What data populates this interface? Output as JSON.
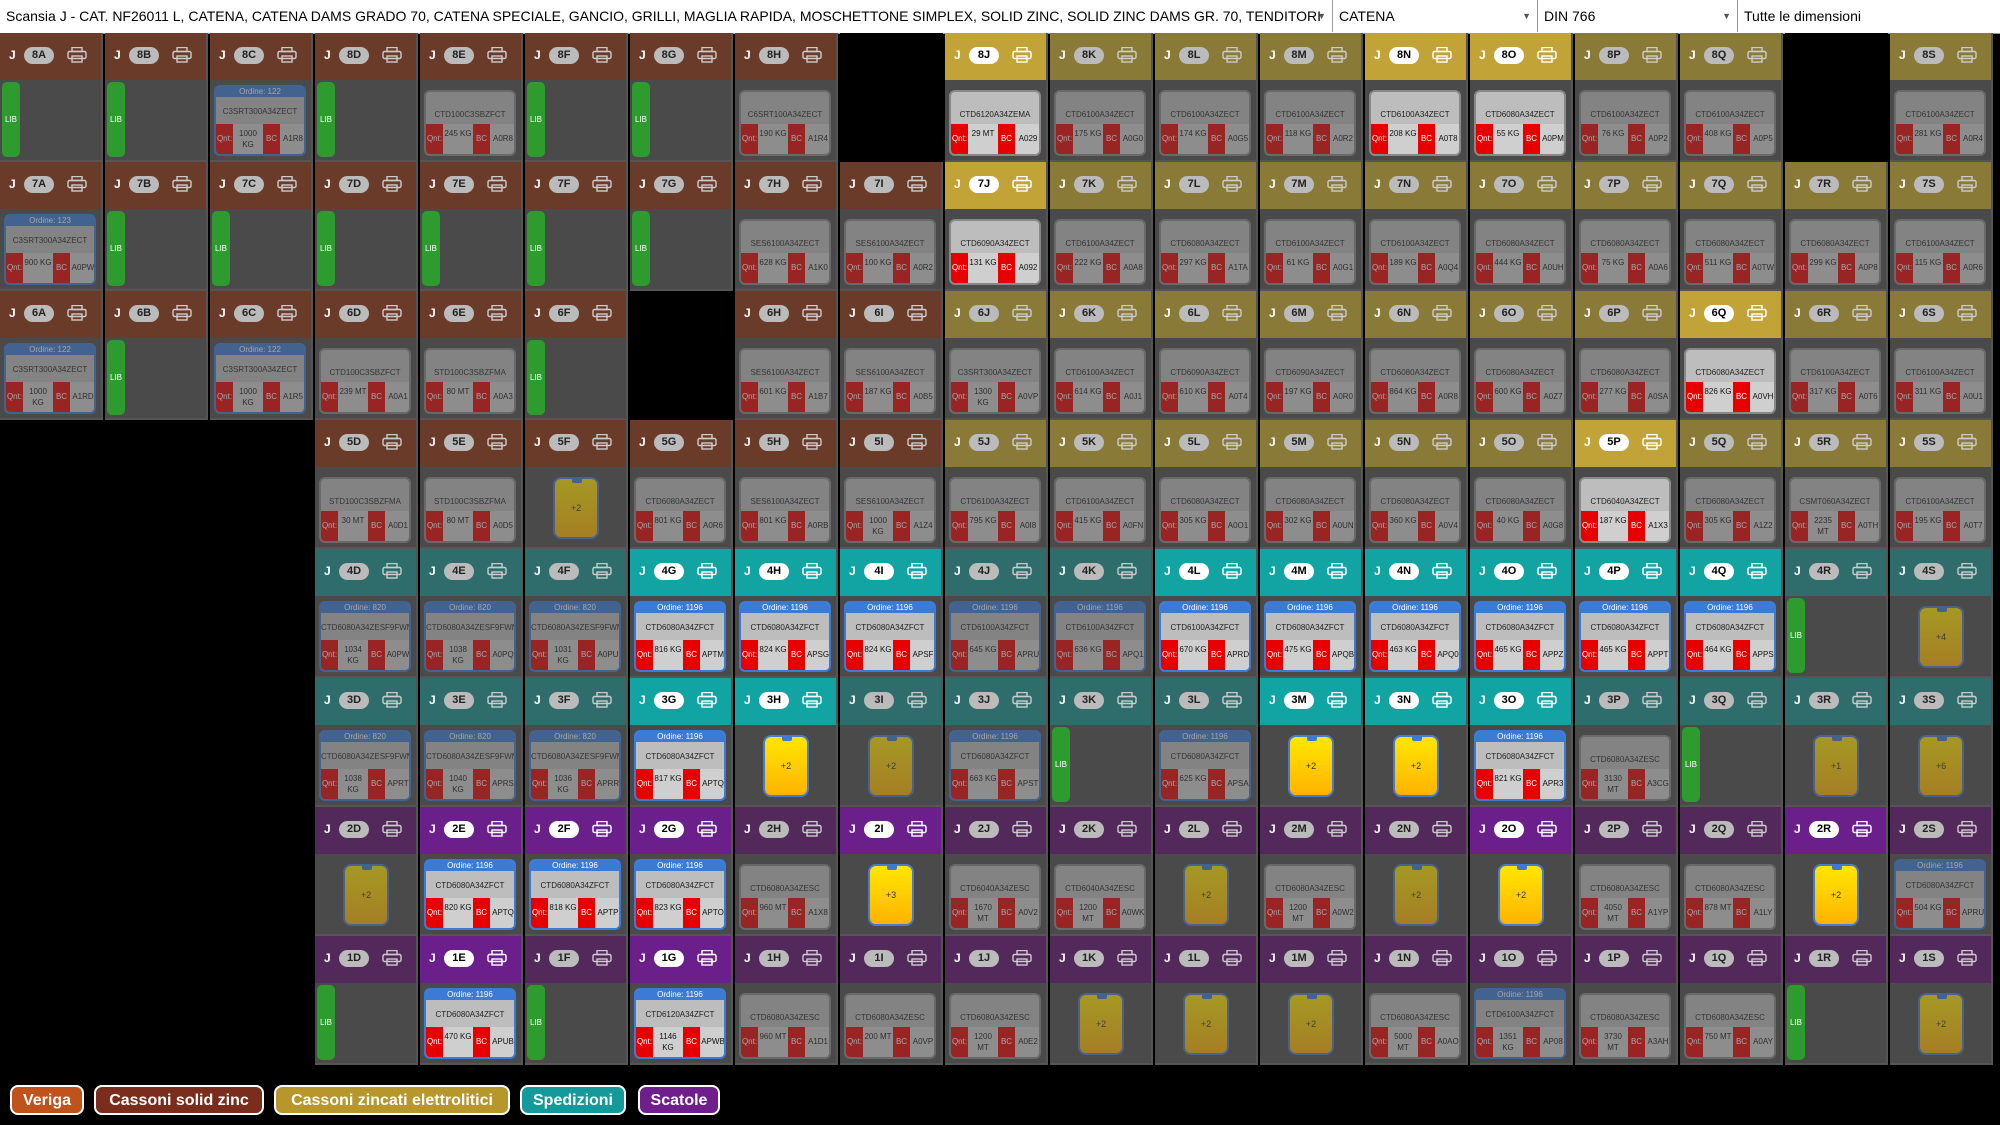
{
  "filters": {
    "scansia": "Scansia J - CAT. NF26011 L, CATENA, CATENA DAMS GRADO 70, CATENA SPECIALE, GANCIO, GRILLI, MAGLIA RAPIDA, MOSCHETTONE SIMPLEX, SOLID ZINC, SOLID ZINC DAMS GR. 70, TENDITORI",
    "category": "CATENA",
    "norm": "DIN 766",
    "dimension": "Tutte le dimensioni"
  },
  "shelf_letter": "J",
  "columns": [
    "A",
    "B",
    "C",
    "D",
    "E",
    "F",
    "G",
    "H",
    "I",
    "J",
    "K",
    "L",
    "M",
    "N",
    "O",
    "P",
    "Q",
    "R",
    "S"
  ],
  "levels": [
    8,
    7,
    6,
    5,
    4,
    3,
    2,
    1
  ],
  "labels": {
    "free": "LIB",
    "qty": "Qnt:",
    "bc": "BC"
  },
  "colors": {
    "veriga": "#7a3a24",
    "solid_zinc": "#6b3b2a",
    "zincati": "#8a7a38",
    "zincati_active": "#c2a338",
    "spedizioni": "#2f6d6d",
    "spedizioni_active": "#12a3a3",
    "scatole": "#52295a",
    "scatole_active": "#6a1f8a"
  },
  "legend": [
    {
      "label": "Veriga",
      "color": "#c0521c"
    },
    {
      "label": "Cassoni solid zinc",
      "color": "#7a2d1c"
    },
    {
      "label": "Cassoni zincati elettrolitici",
      "color": "#b7962c"
    },
    {
      "label": "Spedizioni",
      "color": "#149a9a"
    },
    {
      "label": "Scatole",
      "color": "#6e1f8c"
    }
  ],
  "cells": {
    "8A": {
      "c": "r",
      "t": "lib"
    },
    "8B": {
      "c": "r",
      "t": "lib"
    },
    "8C": {
      "c": "r",
      "t": "box",
      "code": "C3SRT300A34ZECT",
      "q": "1000 KG",
      "id": "A1R8",
      "ord": "Ordine: 122"
    },
    "8D": {
      "c": "r",
      "t": "lib"
    },
    "8E": {
      "c": "r",
      "t": "box",
      "code": "CTD100C3SBZFCT",
      "q": "245 KG",
      "id": "A0R8"
    },
    "8F": {
      "c": "r",
      "t": "lib"
    },
    "8G": {
      "c": "r",
      "t": "lib"
    },
    "8H": {
      "c": "r",
      "t": "box",
      "code": "C6SRT100A34ZECT",
      "q": "190 KG",
      "id": "A1R4"
    },
    "8I": {
      "c": "x"
    },
    "8J": {
      "c": "y",
      "a": 1,
      "t": "box",
      "code": "CTD6120A34ZEMA",
      "q": "29 MT",
      "id": "A029"
    },
    "8K": {
      "c": "y",
      "t": "box",
      "code": "CTD6100A34ZECT",
      "q": "175 KG",
      "id": "A0G0"
    },
    "8L": {
      "c": "y",
      "t": "box",
      "code": "CTD6100A34ZECT",
      "q": "174 KG",
      "id": "A0G5"
    },
    "8M": {
      "c": "y",
      "t": "box",
      "code": "CTD6100A34ZECT",
      "q": "118 KG",
      "id": "A0R2"
    },
    "8N": {
      "c": "y",
      "a": 1,
      "t": "box",
      "code": "CTD6100A34ZECT",
      "q": "208 KG",
      "id": "A0T8"
    },
    "8O": {
      "c": "y",
      "a": 1,
      "t": "box",
      "code": "CTD6080A34ZECT",
      "q": "55 KG",
      "id": "A0PM"
    },
    "8P": {
      "c": "y",
      "t": "box",
      "code": "CTD6100A34ZECT",
      "q": "76 KG",
      "id": "A0P2"
    },
    "8Q": {
      "c": "y",
      "t": "box",
      "code": "CTD6100A34ZECT",
      "q": "408 KG",
      "id": "A0P5"
    },
    "8R": {
      "c": "x"
    },
    "8S": {
      "c": "y",
      "t": "box",
      "code": "CTD6100A34ZECT",
      "q": "281 KG",
      "id": "A0R4"
    },
    "7A": {
      "c": "r",
      "t": "box",
      "code": "C3SRT300A34ZECT",
      "q": "900 KG",
      "id": "A0PW",
      "ord": "Ordine: 123"
    },
    "7B": {
      "c": "r",
      "t": "lib"
    },
    "7C": {
      "c": "r",
      "t": "lib"
    },
    "7D": {
      "c": "r",
      "t": "lib"
    },
    "7E": {
      "c": "r",
      "t": "lib"
    },
    "7F": {
      "c": "r",
      "t": "lib"
    },
    "7G": {
      "c": "r",
      "t": "lib"
    },
    "7H": {
      "c": "r",
      "t": "box",
      "code": "SES6100A34ZECT",
      "q": "628 KG",
      "id": "A1K0"
    },
    "7I": {
      "c": "r",
      "t": "box",
      "code": "SES6100A34ZECT",
      "q": "100 KG",
      "id": "A0R2"
    },
    "7J": {
      "c": "y",
      "a": 1,
      "t": "box",
      "code": "CTD6090A34ZECT",
      "q": "131 KG",
      "id": "A092"
    },
    "7K": {
      "c": "y",
      "t": "box",
      "code": "CTD6100A34ZECT",
      "q": "222 KG",
      "id": "A0A8"
    },
    "7L": {
      "c": "y",
      "t": "box",
      "code": "CTD6080A34ZECT",
      "q": "297 KG",
      "id": "A1TA"
    },
    "7M": {
      "c": "y",
      "t": "box",
      "code": "CTD6100A34ZECT",
      "q": "61 KG",
      "id": "A0G1"
    },
    "7N": {
      "c": "y",
      "t": "box",
      "code": "CTD6100A34ZECT",
      "q": "189 KG",
      "id": "A0Q4"
    },
    "7O": {
      "c": "y",
      "t": "box",
      "code": "CTD6080A34ZECT",
      "q": "444 KG",
      "id": "A0UH"
    },
    "7P": {
      "c": "y",
      "t": "box",
      "code": "CTD6080A34ZECT",
      "q": "75 KG",
      "id": "A0A6"
    },
    "7Q": {
      "c": "y",
      "t": "box",
      "code": "CTD6080A34ZECT",
      "q": "511 KG",
      "id": "A0TW"
    },
    "7R": {
      "c": "y",
      "t": "box",
      "code": "CTD6080A34ZECT",
      "q": "299 KG",
      "id": "A0P8"
    },
    "7S": {
      "c": "y",
      "t": "box",
      "code": "CTD6100A34ZECT",
      "q": "115 KG",
      "id": "A0R6"
    },
    "6A": {
      "c": "r",
      "t": "box",
      "code": "C3SRT300A34ZECT",
      "q": "1000 KG",
      "id": "A1RD",
      "ord": "Ordine: 122"
    },
    "6B": {
      "c": "r",
      "t": "lib"
    },
    "6C": {
      "c": "r",
      "t": "box",
      "code": "C3SRT300A34ZECT",
      "q": "1000 KG",
      "id": "A1R5",
      "ord": "Ordine: 122"
    },
    "6D": {
      "c": "r",
      "t": "box",
      "code": "CTD100C3SBZFCT",
      "q": "239 MT",
      "id": "A0A1"
    },
    "6E": {
      "c": "r",
      "t": "box",
      "code": "STD100C3SBZFMA",
      "q": "80 MT",
      "id": "A0A3"
    },
    "6F": {
      "c": "r",
      "t": "lib"
    },
    "6H": {
      "c": "r",
      "t": "box",
      "code": "SES6100A34ZECT",
      "q": "601 KG",
      "id": "A1B7"
    },
    "6I": {
      "c": "r",
      "t": "box",
      "code": "SES6100A34ZECT",
      "q": "187 KG",
      "id": "A0B5"
    },
    "6J": {
      "c": "y",
      "t": "box",
      "code": "C3SRT300A34ZECT",
      "q": "1300 KG",
      "id": "A0VP"
    },
    "6K": {
      "c": "y",
      "t": "box",
      "code": "CTD6100A34ZECT",
      "q": "614 KG",
      "id": "A0J1"
    },
    "6L": {
      "c": "y",
      "t": "box",
      "code": "CTD6090A34ZECT",
      "q": "610 KG",
      "id": "A0T4"
    },
    "6M": {
      "c": "y",
      "t": "box",
      "code": "CTD6090A34ZECT",
      "q": "197 KG",
      "id": "A0R0"
    },
    "6N": {
      "c": "y",
      "t": "box",
      "code": "CTD6080A34ZECT",
      "q": "864 KG",
      "id": "A0R8"
    },
    "6O": {
      "c": "y",
      "t": "box",
      "code": "CTD6080A34ZECT",
      "q": "600 KG",
      "id": "A0Z7"
    },
    "6P": {
      "c": "y",
      "t": "box",
      "code": "CTD6080A34ZECT",
      "q": "277 KG",
      "id": "A0SA"
    },
    "6Q": {
      "c": "y",
      "a": 1,
      "t": "box",
      "code": "CTD6080A34ZECT",
      "q": "826 KG",
      "id": "A0VH"
    },
    "6R": {
      "c": "y",
      "t": "box",
      "code": "CTD6100A34ZECT",
      "q": "317 KG",
      "id": "A0T6"
    },
    "6S": {
      "c": "y",
      "t": "box",
      "code": "CTD6100A34ZECT",
      "q": "311 KG",
      "id": "A0U1"
    },
    "5A": {
      "c": "x"
    },
    "5B": {
      "c": "x"
    },
    "5C": {
      "c": "x"
    },
    "5D": {
      "c": "r",
      "t": "box",
      "code": "STD100C3SBZFMA",
      "q": "30 MT",
      "id": "A0D1"
    },
    "5E": {
      "c": "r",
      "t": "box",
      "code": "STD100C3SBZFMA",
      "q": "80 MT",
      "id": "A0D5"
    },
    "5F": {
      "c": "r",
      "t": "jar",
      "n": "+2"
    },
    "5G": {
      "c": "r",
      "t": "box",
      "code": "CTD6080A34ZECT",
      "q": "801 KG",
      "id": "A0R6"
    },
    "5H": {
      "c": "r",
      "t": "box",
      "code": "SES6100A34ZECT",
      "q": "801 KG",
      "id": "A0RB"
    },
    "5I": {
      "c": "r",
      "t": "box",
      "code": "SES6100A34ZECT",
      "q": "1000 KG",
      "id": "A1Z4"
    },
    "5J": {
      "c": "y",
      "t": "box",
      "code": "CTD6100A34ZECT",
      "q": "795 KG",
      "id": "A0I8"
    },
    "5K": {
      "c": "y",
      "t": "box",
      "code": "CTD6100A34ZECT",
      "q": "415 KG",
      "id": "A0FN"
    },
    "5L": {
      "c": "y",
      "t": "box",
      "code": "CTD6080A34ZECT",
      "q": "305 KG",
      "id": "A0O1"
    },
    "5M": {
      "c": "y",
      "t": "box",
      "code": "CTD6080A34ZECT",
      "q": "302 KG",
      "id": "A0UN"
    },
    "5N": {
      "c": "y",
      "t": "box",
      "code": "CTD6080A34ZECT",
      "q": "360 KG",
      "id": "A0V4"
    },
    "5O": {
      "c": "y",
      "t": "box",
      "code": "CTD6080A34ZECT",
      "q": "40 KG",
      "id": "A0G8"
    },
    "5P": {
      "c": "y",
      "a": 1,
      "t": "box",
      "code": "CTD6040A34ZECT",
      "q": "187 KG",
      "id": "A1X3"
    },
    "5Q": {
      "c": "y",
      "t": "box",
      "code": "CTD6080A34ZECT",
      "q": "305 KG",
      "id": "A1Z2"
    },
    "5R": {
      "c": "y",
      "t": "box",
      "code": "CSMT060A34ZECT",
      "q": "2235 MT",
      "id": "A0TH"
    },
    "5S": {
      "c": "y",
      "t": "box",
      "code": "CTD6100A34ZECT",
      "q": "195 KG",
      "id": "A0T7"
    },
    "4A": {
      "c": "x"
    },
    "4B": {
      "c": "x"
    },
    "4C": {
      "c": "x"
    },
    "4D": {
      "c": "t",
      "t": "box",
      "code": "CTD6080A34ZESF9FWM",
      "q": "1034 KG",
      "id": "A0PW",
      "ord": "Ordine: 820"
    },
    "4E": {
      "c": "t",
      "t": "box",
      "code": "CTD6080A34ZESF9FWM",
      "q": "1038 KG",
      "id": "A0PQ",
      "ord": "Ordine: 820"
    },
    "4F": {
      "c": "t",
      "t": "box",
      "code": "CTD6080A34ZESF9FWM",
      "q": "1031 KG",
      "id": "A0PU",
      "ord": "Ordine: 820"
    },
    "4G": {
      "c": "t",
      "a": 1,
      "t": "box",
      "code": "CTD6080A34ZFCT",
      "q": "816 KG",
      "id": "APTM",
      "ord": "Ordine: 1196"
    },
    "4H": {
      "c": "t",
      "a": 1,
      "t": "box",
      "code": "CTD6080A34ZFCT",
      "q": "824 KG",
      "id": "APSG",
      "ord": "Ordine: 1196"
    },
    "4I": {
      "c": "t",
      "a": 1,
      "t": "box",
      "code": "CTD6080A34ZFCT",
      "q": "824 KG",
      "id": "APSF",
      "ord": "Ordine: 1196"
    },
    "4J": {
      "c": "t",
      "t": "box",
      "code": "CTD6100A34ZFCT",
      "q": "645 KG",
      "id": "APRU",
      "ord": "Ordine: 1196"
    },
    "4K": {
      "c": "t",
      "t": "box",
      "code": "CTD6100A34ZFCT",
      "q": "636 KG",
      "id": "APQ1",
      "ord": "Ordine: 1196"
    },
    "4L": {
      "c": "t",
      "a": 1,
      "t": "box",
      "code": "CTD6100A34ZFCT",
      "q": "670 KG",
      "id": "APRD",
      "ord": "Ordine: 1196"
    },
    "4M": {
      "c": "t",
      "a": 1,
      "t": "box",
      "code": "CTD6080A34ZFCT",
      "q": "475 KG",
      "id": "APQB",
      "ord": "Ordine: 1196"
    },
    "4N": {
      "c": "t",
      "a": 1,
      "t": "box",
      "code": "CTD6080A34ZFCT",
      "q": "463 KG",
      "id": "APQ0",
      "ord": "Ordine: 1196"
    },
    "4O": {
      "c": "t",
      "a": 1,
      "t": "box",
      "code": "CTD6080A34ZFCT",
      "q": "465 KG",
      "id": "APPZ",
      "ord": "Ordine: 1196"
    },
    "4P": {
      "c": "t",
      "a": 1,
      "t": "box",
      "code": "CTD6080A34ZFCT",
      "q": "465 KG",
      "id": "APPT",
      "ord": "Ordine: 1196"
    },
    "4Q": {
      "c": "t",
      "a": 1,
      "t": "box",
      "code": "CTD6080A34ZFCT",
      "q": "464 KG",
      "id": "APPS",
      "ord": "Ordine: 1196"
    },
    "4R": {
      "c": "t",
      "t": "lib"
    },
    "4S": {
      "c": "t",
      "t": "jar",
      "n": "+4"
    },
    "3A": {
      "c": "x"
    },
    "3B": {
      "c": "x"
    },
    "3C": {
      "c": "x"
    },
    "3D": {
      "c": "t",
      "t": "box",
      "code": "CTD6080A34ZESF9FWM",
      "q": "1038 KG",
      "id": "APRT",
      "ord": "Ordine: 820"
    },
    "3E": {
      "c": "t",
      "t": "box",
      "code": "CTD6080A34ZESF9FWM",
      "q": "1040 KG",
      "id": "APRS",
      "ord": "Ordine: 820"
    },
    "3F": {
      "c": "t",
      "t": "box",
      "code": "CTD6080A34ZESF9FWM",
      "q": "1036 KG",
      "id": "APRR",
      "ord": "Ordine: 820"
    },
    "3G": {
      "c": "t",
      "a": 1,
      "t": "box",
      "code": "CTD6080A34ZFCT",
      "q": "817 KG",
      "id": "APTQ",
      "ord": "Ordine: 1196"
    },
    "3H": {
      "c": "t",
      "a": 1,
      "t": "jar",
      "n": "+2"
    },
    "3I": {
      "c": "t",
      "t": "jar",
      "n": "+2"
    },
    "3J": {
      "c": "t",
      "t": "box",
      "code": "CTD6080A34ZFCT",
      "q": "663 KG",
      "id": "APST",
      "ord": "Ordine: 1196"
    },
    "3K": {
      "c": "t",
      "t": "lib"
    },
    "3L": {
      "c": "t",
      "t": "box",
      "code": "CTD6080A34ZFCT",
      "q": "625 KG",
      "id": "APSA",
      "ord": "Ordine: 1196"
    },
    "3M": {
      "c": "t",
      "a": 1,
      "t": "jar",
      "n": "+2"
    },
    "3N": {
      "c": "t",
      "a": 1,
      "t": "jar",
      "n": "+2"
    },
    "3O": {
      "c": "t",
      "a": 1,
      "t": "box",
      "code": "CTD6080A34ZFCT",
      "q": "821 KG",
      "id": "APR3",
      "ord": "Ordine: 1196"
    },
    "3P": {
      "c": "t",
      "t": "box",
      "code": "CTD6080A34ZESC",
      "q": "3130 MT",
      "id": "A3CG"
    },
    "3Q": {
      "c": "t",
      "t": "lib"
    },
    "3R": {
      "c": "t",
      "t": "jar",
      "n": "+1"
    },
    "3S": {
      "c": "t",
      "t": "jar",
      "n": "+6"
    },
    "2A": {
      "c": "x"
    },
    "2B": {
      "c": "x"
    },
    "2C": {
      "c": "x"
    },
    "2D": {
      "c": "p",
      "t": "jar",
      "n": "+2"
    },
    "2E": {
      "c": "p",
      "a": 1,
      "t": "box",
      "code": "CTD6080A34ZFCT",
      "q": "820 KG",
      "id": "APTQ",
      "ord": "Ordine: 1196"
    },
    "2F": {
      "c": "p",
      "a": 1,
      "t": "box",
      "code": "CTD6080A34ZFCT",
      "q": "818 KG",
      "id": "APTP",
      "ord": "Ordine: 1196"
    },
    "2G": {
      "c": "p",
      "a": 1,
      "t": "box",
      "code": "CTD6080A34ZFCT",
      "q": "823 KG",
      "id": "APTO",
      "ord": "Ordine: 1196"
    },
    "2H": {
      "c": "p",
      "t": "box",
      "code": "CTD6080A34ZESC",
      "q": "960 MT",
      "id": "A1X8"
    },
    "2I": {
      "c": "p",
      "a": 1,
      "t": "jar",
      "n": "+3"
    },
    "2J": {
      "c": "p",
      "t": "box",
      "code": "CTD6040A34ZESC",
      "q": "1670 MT",
      "id": "A0V2"
    },
    "2K": {
      "c": "p",
      "t": "box",
      "code": "CTD6040A34ZESC",
      "q": "1200 MT",
      "id": "A0WK"
    },
    "2L": {
      "c": "p",
      "t": "jar",
      "n": "+2"
    },
    "2M": {
      "c": "p",
      "t": "box",
      "code": "CTD6080A34ZESC",
      "q": "1200 MT",
      "id": "A0W2"
    },
    "2N": {
      "c": "p",
      "t": "jar",
      "n": "+2"
    },
    "2O": {
      "c": "p",
      "a": 1,
      "t": "jar",
      "n": "+2"
    },
    "2P": {
      "c": "p",
      "t": "box",
      "code": "CTD6080A34ZESC",
      "q": "4050 MT",
      "id": "A1YP"
    },
    "2Q": {
      "c": "p",
      "t": "box",
      "code": "CTD6080A34ZESC",
      "q": "878 MT",
      "id": "A1LY"
    },
    "2R": {
      "c": "p",
      "a": 1,
      "t": "jar",
      "n": "+2"
    },
    "2S": {
      "c": "p",
      "t": "box",
      "code": "CTD6080A34ZFCT",
      "q": "504 KG",
      "id": "APRU",
      "ord": "Ordine: 1196"
    },
    "1A": {
      "c": "x"
    },
    "1B": {
      "c": "x"
    },
    "1C": {
      "c": "x"
    },
    "1D": {
      "c": "p",
      "t": "lib"
    },
    "1E": {
      "c": "p",
      "a": 1,
      "t": "box",
      "code": "CTD6080A34ZFCT",
      "q": "470 KG",
      "id": "APUB",
      "ord": "Ordine: 1196"
    },
    "1F": {
      "c": "p",
      "t": "lib"
    },
    "1G": {
      "c": "p",
      "a": 1,
      "t": "box",
      "code": "CTD6120A34ZFCT",
      "q": "1146 KG",
      "id": "APWB",
      "ord": "Ordine: 1196"
    },
    "1H": {
      "c": "p",
      "t": "box",
      "code": "CTD6080A34ZESC",
      "q": "960 MT",
      "id": "A1D1"
    },
    "1I": {
      "c": "p",
      "t": "box",
      "code": "CTD6080A34ZESC",
      "q": "200 MT",
      "id": "A0VP"
    },
    "1J": {
      "c": "p",
      "t": "box",
      "code": "CTD6080A34ZESC",
      "q": "1200 MT",
      "id": "A0E2"
    },
    "1K": {
      "c": "p",
      "t": "jar",
      "n": "+2"
    },
    "1L": {
      "c": "p",
      "t": "jar",
      "n": "+2"
    },
    "1M": {
      "c": "p",
      "t": "jar",
      "n": "+2"
    },
    "1N": {
      "c": "p",
      "t": "box",
      "code": "CTD6080A34ZESC",
      "q": "5000 MT",
      "id": "A0AO"
    },
    "1O": {
      "c": "p",
      "t": "box",
      "code": "CTD6100A34ZFCT",
      "q": "1351 KG",
      "id": "AP08",
      "ord": "Ordine: 1196"
    },
    "1P": {
      "c": "p",
      "t": "box",
      "code": "CTD6080A34ZESC",
      "q": "3730 MT",
      "id": "A3AH"
    },
    "1Q": {
      "c": "p",
      "t": "box",
      "code": "CTD6080A34ZESC",
      "q": "750 MT",
      "id": "A0AY"
    },
    "1R": {
      "c": "p",
      "t": "lib"
    },
    "1S": {
      "c": "p",
      "t": "jar",
      "n": "+2"
    }
  }
}
